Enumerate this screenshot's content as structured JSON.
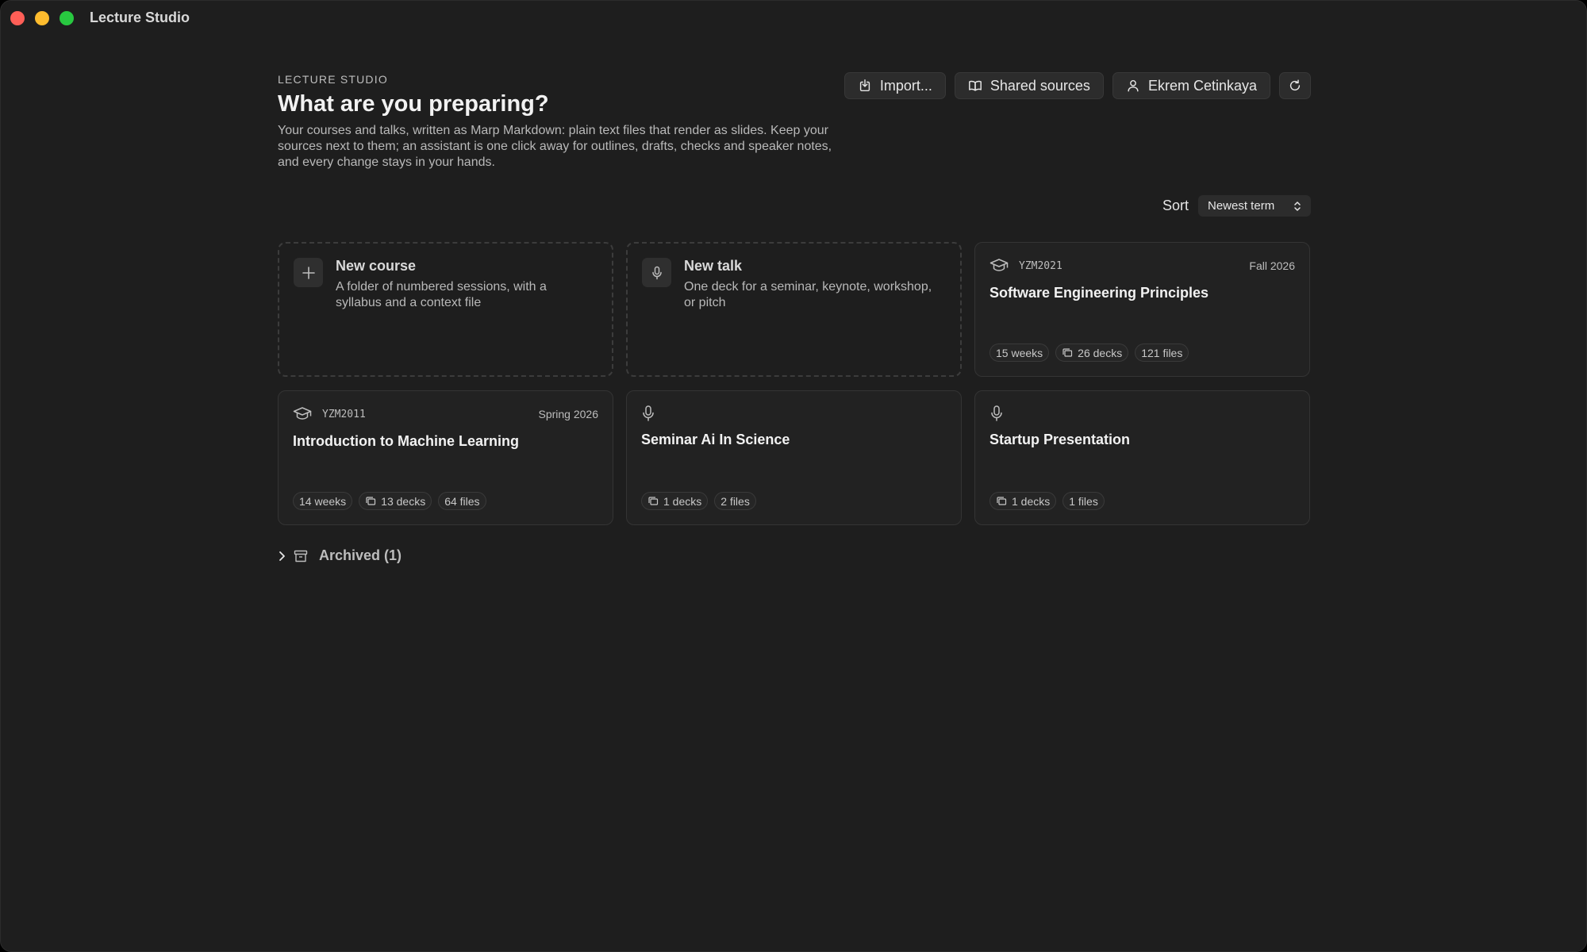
{
  "window": {
    "title": "Lecture Studio"
  },
  "header": {
    "eyebrow": "LECTURE STUDIO",
    "title": "What are you preparing?",
    "description": "Your courses and talks, written as Marp Markdown: plain text files that render as slides. Keep your sources next to them; an assistant is one click away for outlines, drafts, checks and speaker notes, and every change stays in your hands."
  },
  "toolbar": {
    "import_label": "Import...",
    "shared_sources_label": "Shared sources",
    "user_label": "Ekrem Cetinkaya",
    "refresh_icon": "refresh-icon"
  },
  "sort": {
    "label": "Sort",
    "selected": "Newest term"
  },
  "new_items": {
    "course": {
      "title": "New course",
      "description": "A folder of numbered sessions, with a syllabus and a context file"
    },
    "talk": {
      "title": "New talk",
      "description": "One deck for a seminar, keynote, workshop, or pitch"
    }
  },
  "cards": [
    {
      "kind": "course",
      "code": "YZM2021",
      "term": "Fall 2026",
      "title": "Software Engineering Principles",
      "chips": [
        "15 weeks",
        "26 decks",
        "121 files"
      ]
    },
    {
      "kind": "course",
      "code": "YZM2011",
      "term": "Spring 2026",
      "title": "Introduction to Machine Learning",
      "chips": [
        "14 weeks",
        "13 decks",
        "64 files"
      ]
    },
    {
      "kind": "talk",
      "title": "Seminar Ai In Science",
      "chips": [
        "1 decks",
        "2 files"
      ]
    },
    {
      "kind": "talk",
      "title": "Startup Presentation",
      "chips": [
        "1 decks",
        "1 files"
      ]
    }
  ],
  "archived": {
    "label": "Archived (1)"
  },
  "colors": {
    "background": "#1e1e1e",
    "card": "#222222",
    "traffic_red": "#ff5f57",
    "traffic_yellow": "#febc2e",
    "traffic_green": "#28c840"
  }
}
